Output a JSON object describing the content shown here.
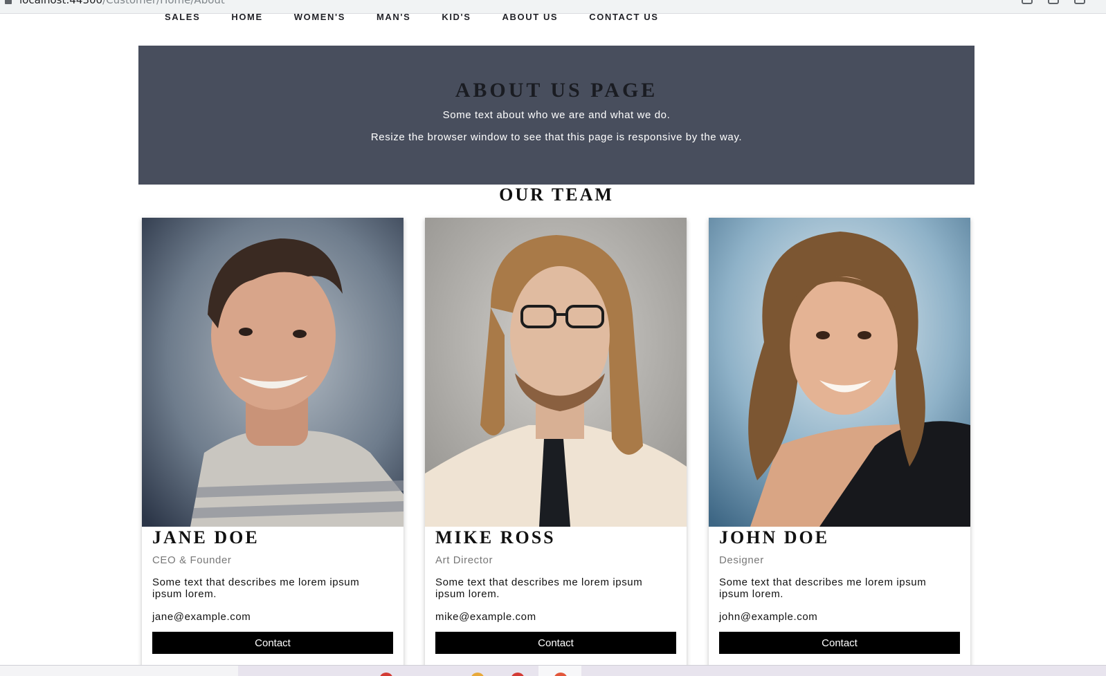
{
  "browser": {
    "url_host": "localhost:44300",
    "url_path": "/Customer/Home/About"
  },
  "nav": {
    "items": [
      "SALES",
      "HOME",
      "WOMEN'S",
      "MAN'S",
      "KID'S",
      "ABOUT US",
      "CONTACT US"
    ]
  },
  "hero": {
    "title": "ABOUT US PAGE",
    "text1": "Some text about who we are and what we do.",
    "text2": "Resize the browser window to see that this page is responsive by the way."
  },
  "team": {
    "title": "OUR TEAM",
    "members": [
      {
        "name": "JANE DOE",
        "role": "CEO & Founder",
        "description": "Some text that describes me lorem ipsum ipsum lorem.",
        "email": "jane@example.com",
        "button": "Contact"
      },
      {
        "name": "MIKE ROSS",
        "role": "Art Director",
        "description": "Some text that describes me lorem ipsum ipsum lorem.",
        "email": "mike@example.com",
        "button": "Contact"
      },
      {
        "name": "JOHN DOE",
        "role": "Designer",
        "description": "Some text that describes me lorem ipsum ipsum lorem.",
        "email": "john@example.com",
        "button": "Contact"
      }
    ]
  },
  "colors": {
    "hero_bg": "#484e5d",
    "button_bg": "#000000",
    "role_text": "#777777"
  }
}
